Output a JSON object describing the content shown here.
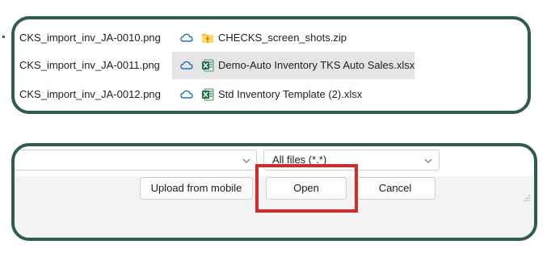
{
  "file_list": {
    "rows": [
      {
        "left_name": "CKS_import_inv_JA-0010.png",
        "right_name": "CHECKS_screen_shots.zip",
        "right_type": "zip-folder-icon",
        "selected": false
      },
      {
        "left_name": "CKS_import_inv_JA-0011.png",
        "right_name": "Demo-Auto Inventory TKS Auto Sales.xlsx",
        "right_type": "excel-file-icon",
        "selected": true
      },
      {
        "left_name": "CKS_import_inv_JA-0012.png",
        "right_name": "Std Inventory Template (2).xlsx",
        "right_type": "excel-file-icon",
        "selected": false
      }
    ]
  },
  "dialog": {
    "filename_value": "",
    "file_type_filter": "All files (*.*)",
    "buttons": {
      "upload": "Upload from mobile",
      "open": "Open",
      "cancel": "Cancel"
    }
  },
  "colors": {
    "panel_border": "#2f5e46",
    "highlight": "#d22b2b",
    "cloud": "#1f6fc5",
    "excel": "#1d7044",
    "zip": "#e8b400"
  }
}
